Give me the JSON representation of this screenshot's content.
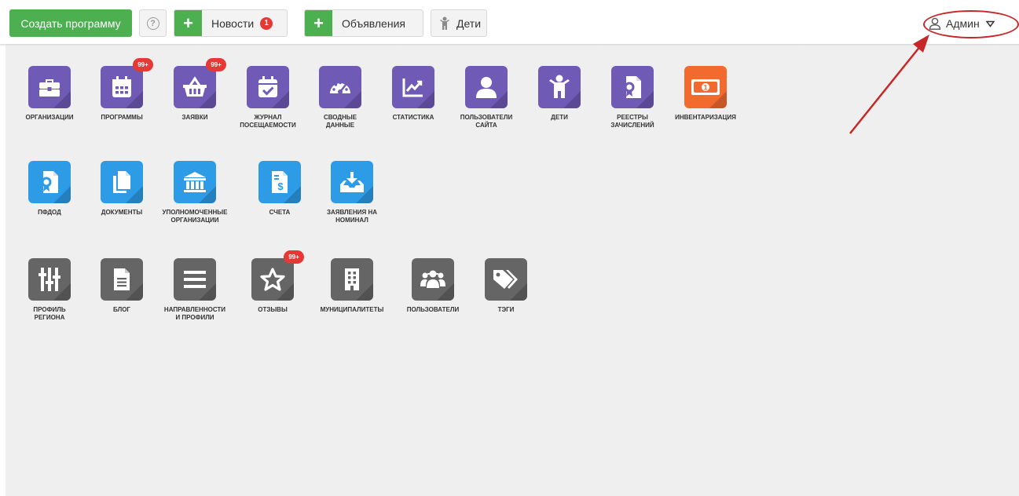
{
  "toolbar": {
    "create_program": "Создать программу",
    "help": "?",
    "news": {
      "plus": "+",
      "label": "Новости",
      "count": "1"
    },
    "announcements": {
      "plus": "+",
      "label": "Объявления"
    },
    "children": "Дети"
  },
  "user_menu": {
    "label": "Админ"
  },
  "colors": {
    "green": "#4caf50",
    "purple_tile": "#6f5ab6",
    "blue_tile": "#2e9be6",
    "gray_tile": "#656565",
    "orange_tile": "#f26a2e",
    "badge_red": "#e53935",
    "annotation_red": "#c62828"
  },
  "tiles": {
    "organizations": {
      "label": "ОРГАНИЗАЦИИ",
      "icon": "briefcase-icon"
    },
    "programs": {
      "label": "ПРОГРАММЫ",
      "icon": "calendar-icon",
      "badge": "99+"
    },
    "applications": {
      "label": "ЗАЯВКИ",
      "icon": "basket-icon",
      "badge": "99+"
    },
    "attendance": {
      "label": "ЖУРНАЛ\nПОСЕЩАЕМОСТИ",
      "icon": "calendar-check-icon"
    },
    "summary": {
      "label": "СВОДНЫЕ\nДАННЫЕ",
      "icon": "speedometer-icon"
    },
    "statistics": {
      "label": "СТАТИСТИКА",
      "icon": "chart-icon"
    },
    "site_users": {
      "label": "ПОЛЬЗОВАТЕЛИ\nСАЙТА",
      "icon": "user-icon"
    },
    "kids": {
      "label": "ДЕТИ",
      "icon": "child-icon"
    },
    "enrollment_registers": {
      "label": "РЕЕСТРЫ\nЗАЧИСЛЕНИЙ",
      "icon": "certificate-icon"
    },
    "inventory": {
      "label": "ИНВЕНТАРИЗАЦИЯ",
      "icon": "banknote-icon"
    },
    "pfdod": {
      "label": "ПФДОД",
      "icon": "certificate-icon"
    },
    "documents": {
      "label": "ДОКУМЕНТЫ",
      "icon": "copy-icon"
    },
    "authorized_orgs": {
      "label": "УПОЛНОМОЧЕННЫЕ\nОРГАНИЗАЦИИ",
      "icon": "bank-icon"
    },
    "invoices": {
      "label": "СЧЕТА",
      "icon": "invoice-icon"
    },
    "nominal_applications": {
      "label": "ЗАЯВЛЕНИЯ НА\nНОМИНАЛ",
      "icon": "inbox-download-icon"
    },
    "region_profile": {
      "label": "ПРОФИЛЬ\nРЕГИОНА",
      "icon": "sliders-icon"
    },
    "blog": {
      "label": "БЛОГ",
      "icon": "document-icon"
    },
    "directions": {
      "label": "НАПРАВЛЕННОСТИ\nИ ПРОФИЛИ",
      "icon": "list-icon"
    },
    "reviews": {
      "label": "ОТЗЫВЫ",
      "icon": "star-icon",
      "badge": "99+"
    },
    "municipalities": {
      "label": "МУНИЦИПАЛИТЕТЫ",
      "icon": "building-icon"
    },
    "users": {
      "label": "ПОЛЬЗОВАТЕЛИ",
      "icon": "users-group-icon"
    },
    "tags": {
      "label": "ТЭГИ",
      "icon": "tag-icon"
    }
  }
}
